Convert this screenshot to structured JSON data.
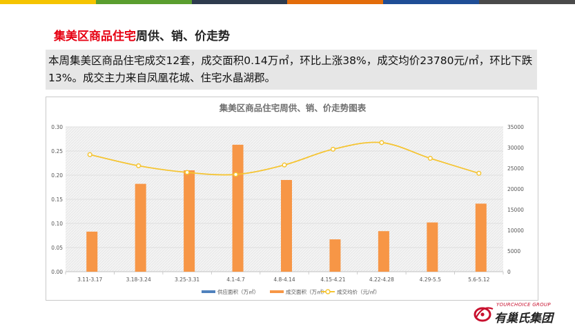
{
  "heading": {
    "highlight": "集美区商品住宅",
    "rest": "周供、销、价走势"
  },
  "summary": "本周集美区商品住宅成交12套，成交面积0.14万㎡，环比上涨38%，成交均价23780元/㎡，环比下跌13%。成交主力来自凤凰花城、住宅水晶湖郡。",
  "logo": {
    "en": "YOURCHOICE GROUP",
    "cn": "有巢氏集团"
  },
  "colors": {
    "bar_top": [
      "#f5c400",
      "#5a9e2f",
      "#2e3b4e",
      "#e36c0a",
      "#1f4e96",
      "#4a4a4a"
    ],
    "supply": "#4f81bd",
    "sold": "#f79646",
    "price": "#f5c431",
    "accent": "#e60012"
  },
  "chart_data": {
    "type": "bar",
    "title": "集美区商品住宅周供、销、价走势图表",
    "categories": [
      "3.11-3.17",
      "3.18-3.24",
      "3.25-3.31",
      "4.1-4.7",
      "4.8-4.14",
      "4.15-4.21",
      "4.22-4.28",
      "4.29-5.5",
      "5.6-5.12"
    ],
    "series": [
      {
        "name": "供应面积（万㎡）",
        "type": "bar",
        "axis": "left",
        "values": [
          0,
          0,
          0,
          0,
          0,
          0,
          0,
          0,
          0
        ]
      },
      {
        "name": "成交面积（万㎡）",
        "type": "bar",
        "axis": "left",
        "values": [
          0.083,
          0.182,
          0.21,
          0.263,
          0.19,
          0.067,
          0.084,
          0.102,
          0.141
        ]
      },
      {
        "name": "成交均价（元/㎡）",
        "type": "line",
        "axis": "right",
        "smooth": true,
        "values": [
          28300,
          25600,
          24000,
          23500,
          25800,
          29600,
          31200,
          27400,
          23780
        ]
      }
    ],
    "ylim_left": [
      0,
      0.3
    ],
    "yticks_left": [
      "0.00",
      "0.05",
      "0.10",
      "0.15",
      "0.20",
      "0.25",
      "0.30"
    ],
    "ylim_right": [
      0,
      35000
    ],
    "yticks_right": [
      "0",
      "5000",
      "10000",
      "15000",
      "20000",
      "25000",
      "30000",
      "35000"
    ],
    "grid": true,
    "legend_position": "bottom"
  }
}
